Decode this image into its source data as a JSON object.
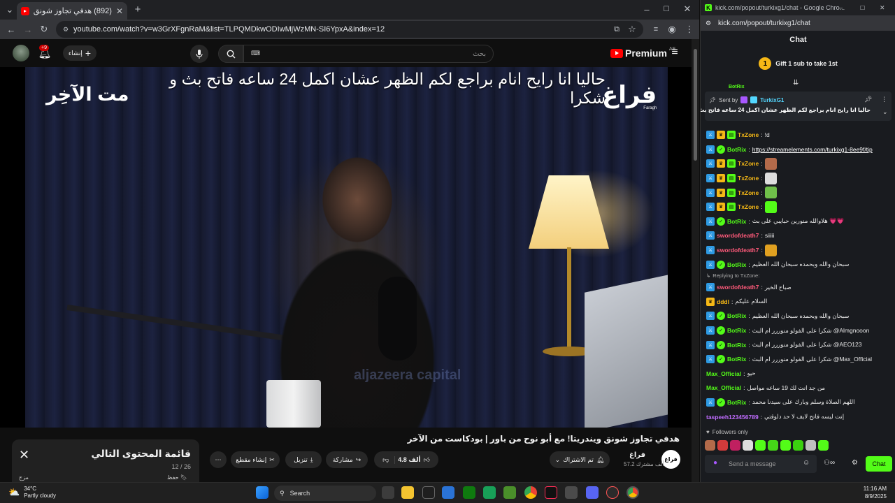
{
  "browser_left": {
    "tab_title": "(892) هدفي تجاوز شونق ويند",
    "tab_close": "✕",
    "new_tab": "+",
    "url": "youtube.com/watch?v=w3GrXFgnRaM&list=TLPQMDkwODIwMjWzMN-SI6YpxA&index=12"
  },
  "youtube": {
    "logo_text": "Premium",
    "logo_region": "AE",
    "search_placeholder": "بحث",
    "create_label": "إنشاء",
    "notif_count": "+9",
    "video": {
      "caption_overlay": "حاليا انا رايح انام براجع لكم الظهر عشان اكمل 24 ساعه فاتح بث و شكرا",
      "brand_right": "فراغ",
      "brand_right_sub": "Faragh",
      "brand_left": "مت الآخِر",
      "watermark": "aljazeera capital"
    },
    "title": "هدفي تجاوز شونق ويندريتا! مع أبو نوح من باور | بودكاست من الآخر",
    "channel": {
      "avatar_text": "فراغ",
      "name": "فراغ",
      "subscribers": "57.2 ألف مشترك"
    },
    "actions": {
      "subscribed": "تم الاشتراك",
      "likes": "4.8 ألف",
      "share": "مشاركة",
      "download": "تنزيل",
      "clip": "إنشاء مقطع",
      "more": "⋯"
    },
    "playlist": {
      "title": "قائمة المحتوى التالي",
      "count": "12 / 26",
      "save": "حفظ",
      "mix": "مزج"
    }
  },
  "kick": {
    "window_title": "kick.com/popout/turkixg1/chat - Google Chro...",
    "url": "kick.com/popout/turkixg1/chat",
    "header": "Chat",
    "gift": {
      "coin": "1",
      "text": "Gift 1 sub to take 1st"
    },
    "pinned": {
      "sent_by_label": "Sent by",
      "sender": "TurkixG1",
      "message": "حاليا انا رايح انام براجع لكم الظهر عشان اكمل 24 ساعه فاتح بث و شكرا"
    },
    "messages": [
      {
        "user": "TxZone",
        "color": "#f5b816",
        "badges": [
          "mod",
          "vip",
          "sub"
        ],
        "text": "!d"
      },
      {
        "user": "BotRix",
        "color": "#53fc18",
        "badges": [
          "mod",
          "bot"
        ],
        "text": "https://streamelements.com/turkixg1-8ee9f/tip",
        "link": true
      },
      {
        "user": "TxZone",
        "color": "#f5b816",
        "badges": [
          "mod",
          "vip",
          "sub"
        ],
        "text": "",
        "emote": "#b36a4a"
      },
      {
        "user": "TxZone",
        "color": "#f5b816",
        "badges": [
          "mod",
          "vip",
          "sub"
        ],
        "text": "",
        "emote": "#dddddd"
      },
      {
        "user": "TxZone",
        "color": "#f5b816",
        "badges": [
          "mod",
          "vip",
          "sub"
        ],
        "text": "",
        "emote": "#6fbf4a"
      },
      {
        "user": "TxZone",
        "color": "#f5b816",
        "badges": [
          "mod",
          "vip",
          "sub"
        ],
        "text": "",
        "emote": "#53fc18"
      },
      {
        "user": "BotRix",
        "color": "#53fc18",
        "badges": [
          "mod",
          "bot"
        ],
        "text": "هلاوالله منورين حبايبي على بث 💗💗"
      },
      {
        "user": "swordofdeath7",
        "color": "#ff5a7a",
        "badges": [
          "mod"
        ],
        "text": "siiiii"
      },
      {
        "user": "swordofdeath7",
        "color": "#ff5a7a",
        "badges": [
          "mod"
        ],
        "text": "",
        "emote": "#e0a020"
      },
      {
        "user": "BotRix",
        "color": "#53fc18",
        "badges": [
          "mod",
          "bot"
        ],
        "text": "سبحان والله وبحمده سبحان الله العظيم"
      },
      {
        "reply_to": "Replying to TxZone:",
        "user": "swordofdeath7",
        "color": "#ff5a7a",
        "badges": [
          "mod"
        ],
        "text": "صباح الخير"
      },
      {
        "user": "dddl",
        "color": "#f5b816",
        "badges": [
          "vip"
        ],
        "text": "السلام عليكم"
      },
      {
        "user": "BotRix",
        "color": "#53fc18",
        "badges": [
          "mod",
          "bot"
        ],
        "text": "سبحان والله وبحمده سبحان الله العظيم"
      },
      {
        "user": "BotRix",
        "color": "#53fc18",
        "badges": [
          "mod",
          "bot"
        ],
        "text": "شكرا على الفولو منوررر ام البث @Almgnooon"
      },
      {
        "user": "BotRix",
        "color": "#53fc18",
        "badges": [
          "mod",
          "bot"
        ],
        "text": "شكرا على الفولو منوررر ام البث @AEO123"
      },
      {
        "user": "BotRix",
        "color": "#53fc18",
        "badges": [
          "mod",
          "bot"
        ],
        "text": "شكرا على الفولو منوررر ام البث @Max_Official"
      },
      {
        "user": "Max_Official",
        "color": "#53fc18",
        "badges": [],
        "text": "حيو"
      },
      {
        "user": "Max_Official",
        "color": "#53fc18",
        "badges": [],
        "text": "من جد انت لك 19 ساعه مواصل"
      },
      {
        "user": "BotRix",
        "color": "#53fc18",
        "badges": [
          "mod",
          "bot"
        ],
        "text": "اللهم الصلاة وسلم وبارك على سيدنا محمد"
      },
      {
        "user": "taspeeh123456789",
        "color": "#c06cff",
        "badges": [],
        "text": "إنت ليسه فاتح لايف لا حد دلوقتي"
      }
    ],
    "followers_only": "Followers only",
    "input_placeholder": "Send a message",
    "chat_button": "Chat"
  },
  "taskbar": {
    "temp": "34°C",
    "weather": "Partly cloudy",
    "search": "Search",
    "time": "11:16 AM",
    "date": "8/9/2025"
  }
}
